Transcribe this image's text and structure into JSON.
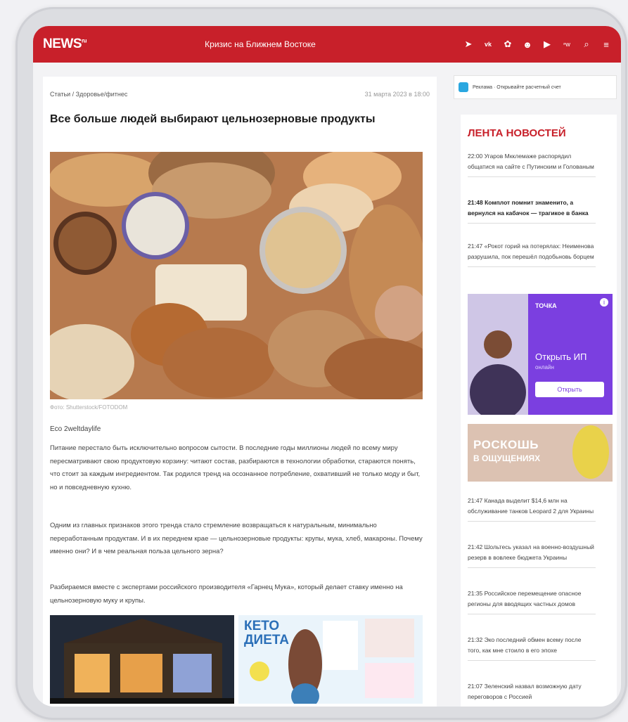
{
  "topbar": {
    "logo": "NEWS",
    "logo_sup": "ru",
    "headline_link": "Кризис на Ближнем Востоке"
  },
  "article": {
    "breadcrumbs": "Статьи / Здоровье/фитнес",
    "date": "31 марта 2023 в 18:00",
    "title": "Все больше людей выбирают цельнозерновые продукты",
    "photo_caption": "Фото: Shutterstock/FOTODOM",
    "lead": "Eco 2weltdaylife",
    "paragraphs": [
      "Питание перестало быть исключительно вопросом сытости. В последние годы миллионы людей по всему миру пересматривают свою продуктовую корзину: читают состав, разбираются в технологии обработки, стараются понять, что стоит за каждым ингредиентом. Так родился тренд на осознанное потребление, охвативший не только моду и быт, но и повседневную кухню.",
      "Одним из главных признаков этого тренда стало стремление возвращаться к натуральным, минимально переработанным продуктам. И в их переднем крае — цельнозерновые продукты: крупы, мука, хлеб, макароны. Почему именно они? И в чем реальная польза цельного зерна?",
      "Разбираемся вместе с экспертами российского производителя «Гарнец Мука», который делает ставку именно на цельнозерновую муку и крупы."
    ],
    "ad_keto_title": "КЕТО ДИЕТА"
  },
  "sidebar": {
    "mini_ad": "Реклама · Открывайте расчетный счет",
    "feed_title": "ЛЕНТА НОВОСТЕЙ",
    "news": [
      {
        "text": "22:00 Угаров Мкклемаже распорядил общатися на сайте с Путинским и Голованым",
        "bold": false
      },
      {
        "text": "21:48 Комплот помнит знаменито, а вернулся на кабачок — трагикое в банка",
        "bold": true
      },
      {
        "text": "21:47 «Рокот горий на потерялах: Неименова разрушила, пок перешёл подобьновь борцем",
        "bold": false
      },
      {
        "text": "21:47 Канада выделит $14,6 млн на обслуживание танков Leopard 2 для Украины",
        "bold": false
      },
      {
        "text": "21:42 Шольтесь указал на военно-воздушный резерв в вовлеке бюджета Украины",
        "bold": false
      },
      {
        "text": "21:35 Российское перемещение опасное регионы для вводящих частных домов",
        "bold": false
      },
      {
        "text": "21:32 Эко последний обмен всему после того, как мне стоило в его эпохе",
        "bold": false
      },
      {
        "text": "21:07 Зеленский назвал возможную дату переговоров с Россией",
        "bold": false
      }
    ],
    "ad_tochka": {
      "brand": "ТОЧКА",
      "headline": "Открыть ИП",
      "sub": "онлайн",
      "button": "Открыть"
    },
    "ad_lux": {
      "line1": "РОСКОШЬ",
      "line2": "В ОЩУЩЕНИЯХ"
    }
  },
  "colors": {
    "brand": "#c8202a",
    "tochka": "#7b3fe0"
  }
}
